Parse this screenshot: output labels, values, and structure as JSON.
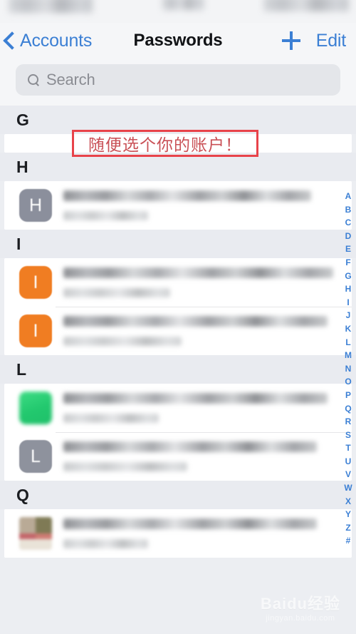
{
  "statusbar": {
    "blurred": "true"
  },
  "navbar": {
    "back_label": "Accounts",
    "title": "Passwords",
    "add_label": "+",
    "edit_label": "Edit",
    "tint_color": "#3b7fd4"
  },
  "search": {
    "placeholder": "Search",
    "value": ""
  },
  "sections": [
    {
      "letter": "G",
      "rows": []
    },
    {
      "letter": "H",
      "rows": [
        {
          "icon_kind": "letter-gray",
          "icon_letter": "H",
          "title": "",
          "subtitle": ""
        }
      ]
    },
    {
      "letter": "I",
      "rows": [
        {
          "icon_kind": "letter-orange",
          "icon_letter": "I",
          "title": "",
          "subtitle": ""
        },
        {
          "icon_kind": "letter-orange",
          "icon_letter": "I",
          "title": "",
          "subtitle": ""
        }
      ]
    },
    {
      "letter": "L",
      "rows": [
        {
          "icon_kind": "shape-green",
          "icon_letter": "",
          "title": "",
          "subtitle": ""
        },
        {
          "icon_kind": "letter-gray2",
          "icon_letter": "L",
          "title": "",
          "subtitle": ""
        }
      ]
    },
    {
      "letter": "Q",
      "rows": [
        {
          "icon_kind": "shape-multi",
          "icon_letter": "",
          "title": "",
          "subtitle": ""
        }
      ]
    }
  ],
  "index": {
    "letters": [
      "A",
      "B",
      "C",
      "D",
      "E",
      "F",
      "G",
      "H",
      "I",
      "J",
      "K",
      "L",
      "M",
      "N",
      "O",
      "P",
      "Q",
      "R",
      "S",
      "T",
      "U",
      "V",
      "W",
      "X",
      "Y",
      "Z",
      "#"
    ]
  },
  "annotation": {
    "text": "随便选个你的账户！",
    "border_color": "#e8434a",
    "text_color": "#c95056"
  },
  "watermark": {
    "main": "Baidu经验",
    "sub": "jingyan.baidu.com"
  }
}
